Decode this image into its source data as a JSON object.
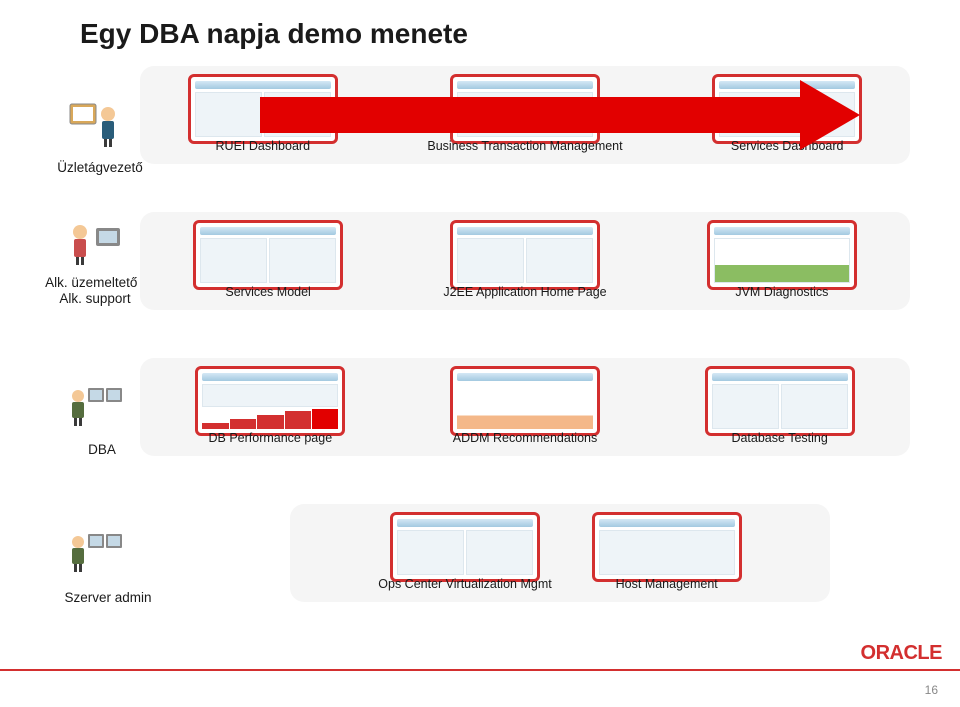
{
  "title": "Egy DBA napja demo menete",
  "roles": {
    "role1": "Üzletágvezető",
    "role2": "Alk. üzemeltető / Alk. support",
    "role3": "DBA",
    "role4": "Szerver admin"
  },
  "row1": {
    "item1": "RUEI Dashboard",
    "item2": "Business Transaction Management",
    "item3": "Services Dashboard"
  },
  "row2": {
    "item1": "Services Model",
    "item2": "J2EE Application Home Page",
    "item3": "JVM Diagnostics"
  },
  "row3": {
    "item1": "DB Performance page",
    "item2": "ADDM Recommendations",
    "item3": "Database Testing"
  },
  "row4": {
    "item1": "Ops Center Virtualization Mgmt",
    "item2": "Host Management"
  },
  "footer": {
    "logo": "ORACLE",
    "page": "16"
  }
}
